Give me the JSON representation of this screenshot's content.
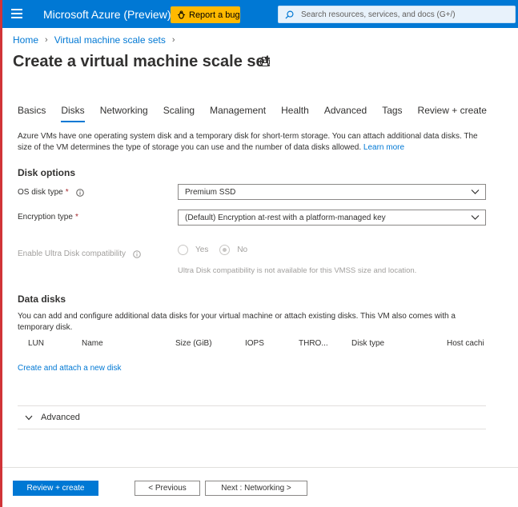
{
  "header": {
    "brand": "Microsoft Azure (Preview)",
    "bug_button": "Report a bug",
    "search_placeholder": "Search resources, services, and docs (G+/)",
    "accent": "#0078d4",
    "bug_color": "#ffb900"
  },
  "breadcrumb": [
    "Home",
    "Virtual machine scale sets"
  ],
  "page_title": "Create a virtual machine scale set",
  "tabs": [
    "Basics",
    "Disks",
    "Networking",
    "Scaling",
    "Management",
    "Health",
    "Advanced",
    "Tags",
    "Review + create"
  ],
  "active_tab": "Disks",
  "intro": {
    "text": "Azure VMs have one operating system disk and a temporary disk for short-term storage. You can attach additional data disks. The size of the VM determines the type of storage you can use and the number of data disks allowed.",
    "link": "Learn more"
  },
  "disk_options": {
    "heading": "Disk options",
    "os_disk_label": "OS disk type",
    "os_disk_value": "Premium SSD",
    "encryption_label": "Encryption type",
    "encryption_value": "(Default) Encryption at-rest with a platform-managed key",
    "required_mark": "*",
    "ultra_label": "Enable Ultra Disk compatibility",
    "ultra_yes": "Yes",
    "ultra_no": "No",
    "ultra_selected": "No",
    "ultra_note": "Ultra Disk compatibility is not available for this VMSS size and location."
  },
  "data_disks": {
    "heading": "Data disks",
    "text": "You can add and configure additional data disks for your virtual machine or attach existing disks. This VM also comes with a temporary disk.",
    "columns": [
      "LUN",
      "Name",
      "Size (GiB)",
      "IOPS",
      "THRO...",
      "Disk type",
      "Host cachi"
    ],
    "create_link": "Create and attach a new disk"
  },
  "advanced": {
    "label": "Advanced"
  },
  "footer": {
    "review_create": "Review + create",
    "previous": "< Previous",
    "next": "Next : Networking >"
  }
}
